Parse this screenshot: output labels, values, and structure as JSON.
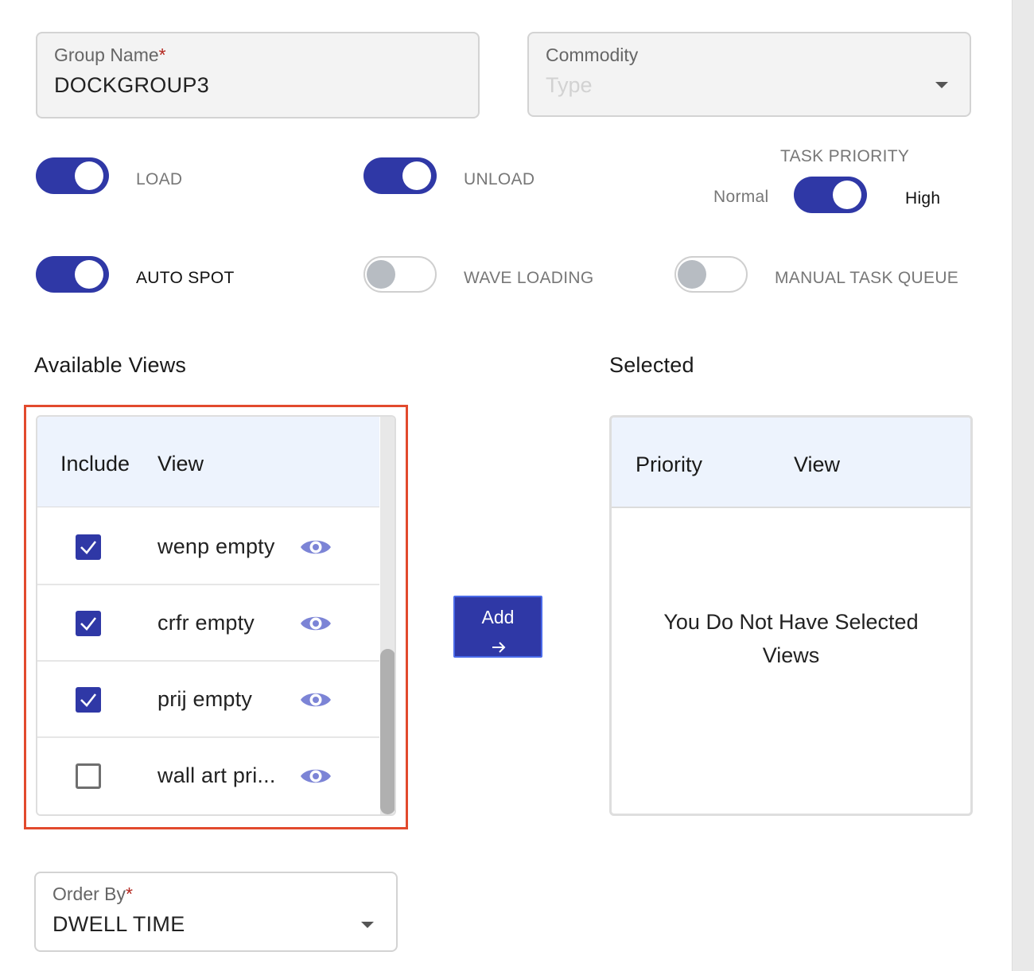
{
  "group_name": {
    "label": "Group Name",
    "required_mark": "*",
    "value": "DOCKGROUP3"
  },
  "commodity": {
    "label": "Commodity",
    "placeholder": "Type"
  },
  "toggles": {
    "load": {
      "label": "LOAD",
      "on": true
    },
    "unload": {
      "label": "UNLOAD",
      "on": true
    },
    "task_priority": {
      "title": "TASK PRIORITY",
      "left_label": "Normal",
      "right_label": "High",
      "on": true
    },
    "auto_spot": {
      "label": "AUTO SPOT",
      "on": true
    },
    "wave_loading": {
      "label": "WAVE LOADING",
      "on": false
    },
    "manual_task_queue": {
      "label": "MANUAL TASK QUEUE",
      "on": false
    }
  },
  "available_views": {
    "title": "Available Views",
    "columns": [
      "Include",
      "View"
    ],
    "rows": [
      {
        "label": "wenp empty",
        "checked": true
      },
      {
        "label": "crfr empty",
        "checked": true
      },
      {
        "label": "prij empty",
        "checked": true
      },
      {
        "label": "wall art pri...",
        "checked": false
      }
    ]
  },
  "add_button": {
    "label": "Add",
    "arrow": "→"
  },
  "selected": {
    "title": "Selected",
    "columns": [
      "Priority",
      "View"
    ],
    "empty_message": "You Do Not Have Selected Views"
  },
  "order_by": {
    "label": "Order By",
    "required_mark": "*",
    "value": "DWELL TIME"
  },
  "colors": {
    "primary": "#2f38a6",
    "highlight": "#e24a2d",
    "eye_icon": "#7c84d6",
    "header_bg": "#edf3fd"
  },
  "icons": {
    "view": "eye-icon",
    "checkbox": "checkmark-icon",
    "dropdown": "caret-down-icon"
  }
}
